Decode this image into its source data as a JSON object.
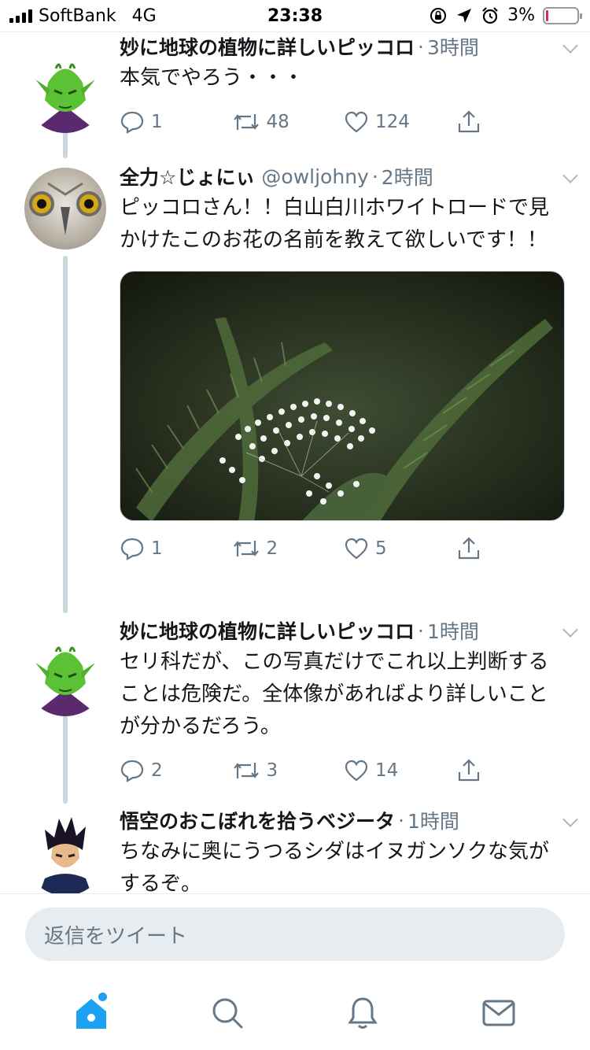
{
  "status_bar": {
    "carrier": "SoftBank",
    "network": "4G",
    "time": "23:38",
    "battery": "3%",
    "battery_level": 0.03,
    "battery_color": "#e0245e"
  },
  "tweets": [
    {
      "name": "妙に地球の植物に詳しいピッコロ",
      "handle": "",
      "time": "3時間",
      "avatar": "piccolo-avatar",
      "text": "本気でやろう・・・",
      "has_media": false,
      "replies": "1",
      "retweets": "48",
      "likes": "124"
    },
    {
      "name": "全力☆じょにぃ",
      "handle": "@owljohny",
      "time": "2時間",
      "avatar": "owl-avatar",
      "text": "ピッコロさん！！白山白川ホワイトロードで見かけたこのお花の名前を教えて欲しいです！！",
      "has_media": true,
      "media": "white-umbellifer-flower-photo",
      "replies": "1",
      "retweets": "2",
      "likes": "5"
    },
    {
      "name": "妙に地球の植物に詳しいピッコロ",
      "handle": "",
      "time": "1時間",
      "avatar": "piccolo-avatar",
      "text": "セリ科だが、この写真だけでこれ以上判断することは危険だ。全体像があればより詳しいことが分かるだろう。",
      "has_media": false,
      "replies": "2",
      "retweets": "3",
      "likes": "14"
    },
    {
      "name": "悟空のおこぼれを拾うベジータ",
      "handle": "",
      "time": "1時間",
      "avatar": "vegeta-avatar",
      "text": "ちなみに奥にうつるシダはイヌガンソクな気がするぞ。",
      "has_media": false
    }
  ],
  "reply": {
    "placeholder": "返信をツイート"
  },
  "tabbar": {
    "items": [
      "home-icon",
      "search-icon",
      "notifications-icon",
      "messages-icon"
    ],
    "accent": "#1da1f2"
  },
  "colors": {
    "accent": "#1da1f2",
    "text": "#14171a",
    "secondary": "#657786"
  }
}
